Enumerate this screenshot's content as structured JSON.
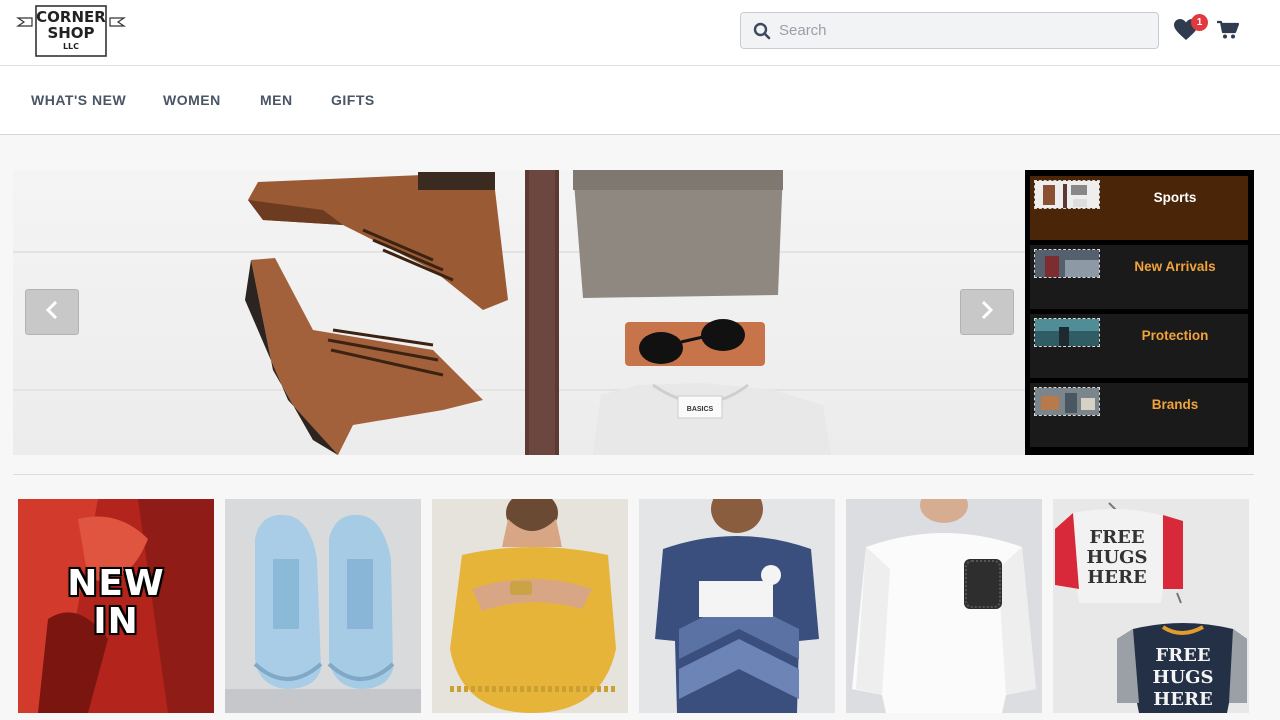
{
  "header": {
    "logo_text": [
      "CORNER",
      "SHOP",
      "LLC"
    ],
    "search_placeholder": "Search",
    "wishlist_count": "1"
  },
  "nav": {
    "items": [
      {
        "label": "WHAT'S NEW"
      },
      {
        "label": "WOMEN"
      },
      {
        "label": "MEN"
      },
      {
        "label": "GIFTS"
      }
    ]
  },
  "hero": {
    "tshirt_tag": "BASICS"
  },
  "categories": [
    {
      "label": "Sports",
      "active": true
    },
    {
      "label": "New Arrivals",
      "active": false
    },
    {
      "label": "Protection",
      "active": false
    },
    {
      "label": "Brands",
      "active": false
    }
  ],
  "tiles": [
    {
      "name": "new-in",
      "overlay": [
        "NEW",
        "IN"
      ]
    },
    {
      "name": "sneakers"
    },
    {
      "name": "yellow-top"
    },
    {
      "name": "football-jersey"
    },
    {
      "name": "white-sweatshirt"
    },
    {
      "name": "kids-tees",
      "print_text": [
        "FREE",
        "HUGS",
        "HERE"
      ]
    }
  ],
  "colors": {
    "accent": "#f0a33b",
    "active_category": "#4a2507",
    "badge": "#e0393e",
    "nav_text": "#4a5566"
  }
}
